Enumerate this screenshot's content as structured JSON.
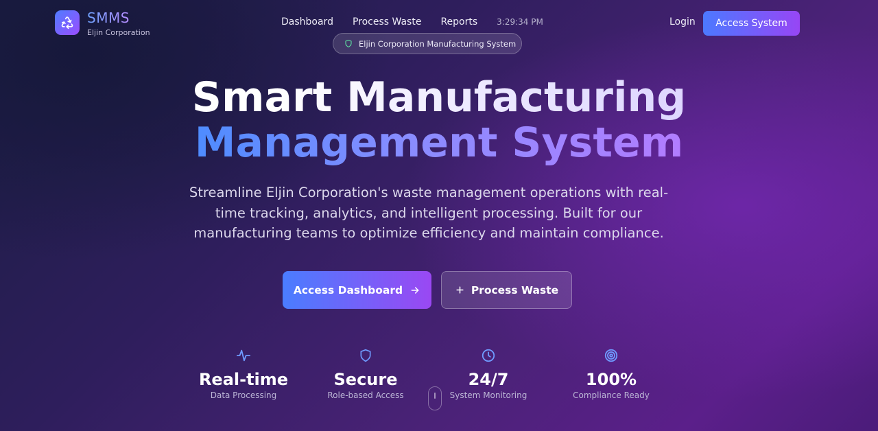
{
  "brand": {
    "name": "SMMS",
    "subtitle": "Eljin Corporation",
    "logo_icon": "recycle-icon",
    "accent_start": "#4f7cff",
    "accent_end": "#9b4dff"
  },
  "nav": {
    "items": [
      {
        "label": "Dashboard"
      },
      {
        "label": "Process Waste"
      },
      {
        "label": "Reports"
      }
    ],
    "clock": "3:29:34 PM",
    "login_label": "Login",
    "access_system_label": "Access System"
  },
  "badge": {
    "icon": "shield-icon",
    "text": "Eljin Corporation Manufacturing System"
  },
  "hero": {
    "title_line1": "Smart Manufacturing",
    "title_line2": "Management System",
    "description": "Streamline Eljin Corporation's waste management operations with real-time tracking, analytics, and intelligent processing. Built for our manufacturing teams to optimize efficiency and maintain compliance.",
    "primary_button": "Access Dashboard",
    "primary_button_icon": "arrow-right-icon",
    "secondary_button": "Process Waste",
    "secondary_button_icon": "plus-icon"
  },
  "stats": [
    {
      "icon": "activity-icon",
      "value": "Real-time",
      "label": "Data Processing"
    },
    {
      "icon": "shield-icon",
      "value": "Secure",
      "label": "Role-based Access"
    },
    {
      "icon": "clock-icon",
      "value": "24/7",
      "label": "System Monitoring"
    },
    {
      "icon": "target-icon",
      "value": "100%",
      "label": "Compliance Ready"
    }
  ]
}
